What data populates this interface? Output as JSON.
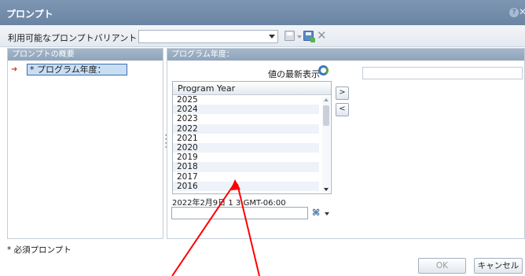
{
  "window": {
    "title": "プロンプト",
    "help": "?",
    "close": "✕"
  },
  "toolbar": {
    "variant_label": "利用可能なプロンプトバリアント",
    "variant_value": ""
  },
  "left_panel": {
    "header": "プロンプトの概要",
    "item": "* プログラム年度："
  },
  "right_panel": {
    "header": "プログラム年度：",
    "refresh_label": "値の最新表示",
    "list": {
      "header": "Program Year",
      "items": [
        "2025",
        "2024",
        "2023",
        "2022",
        "2021",
        "2020",
        "2019",
        "2018",
        "2017",
        "2016"
      ]
    },
    "move_right": ">",
    "move_left": "<",
    "timestamp": "2022年2月9日 1       3:GMT-06:00"
  },
  "footer": {
    "required_note": "* 必須プロンプト",
    "ok": "OK",
    "cancel": "キャンセル"
  },
  "colors": {
    "titlebar": "#7189a8",
    "annotation": "#ff0000",
    "selection": "#c9def3"
  }
}
